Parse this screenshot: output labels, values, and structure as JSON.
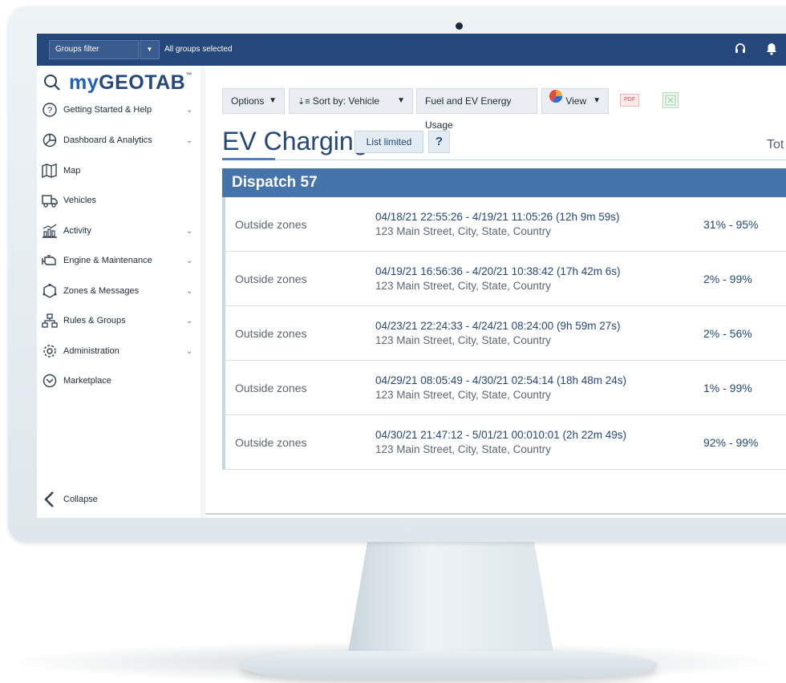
{
  "topbar": {
    "groups_filter_label": "Groups filter",
    "groups_selected_text": "All groups selected",
    "headset_icon": "headset-icon",
    "bell_icon": "bell-icon"
  },
  "sidebar": {
    "logo": {
      "my": "my",
      "rest": "GEOTAB",
      "tm": "™"
    },
    "items": [
      {
        "label": "Getting Started & Help",
        "icon": "question-circle-icon",
        "chevron": "⌄"
      },
      {
        "label": "Dashboard & Analytics",
        "icon": "pie-chart-icon",
        "chevron": "⌄"
      },
      {
        "label": "Map",
        "icon": "map-icon",
        "chevron": ""
      },
      {
        "label": "Vehicles",
        "icon": "truck-icon",
        "chevron": ""
      },
      {
        "label": "Activity",
        "icon": "activity-chart-icon",
        "chevron": "⌄"
      },
      {
        "label": "Engine & Maintenance",
        "icon": "engine-icon",
        "chevron": "⌄"
      },
      {
        "label": "Zones & Messages",
        "icon": "zones-icon",
        "chevron": "⌄"
      },
      {
        "label": "Rules & Groups",
        "icon": "hierarchy-icon",
        "chevron": "⌄"
      },
      {
        "label": "Administration",
        "icon": "gear-icon",
        "chevron": "⌄"
      },
      {
        "label": "Marketplace",
        "icon": "marketplace-icon",
        "chevron": ""
      }
    ],
    "collapse_label": "Collapse"
  },
  "toolbar": {
    "options_label": "Options",
    "sort_label": "Sort by: Vehicle",
    "report_label": "Fuel and EV Energy Usage",
    "view_label": "View",
    "pdf_label": "PDF"
  },
  "page": {
    "title": "EV Charging",
    "list_limited_label": "List limited",
    "help_label": "?",
    "total_label": "Tot"
  },
  "group": {
    "name": "Dispatch 57",
    "rows": [
      {
        "zone": "Outside zones",
        "time": "04/18/21 22:55:26 - 4/19/21 11:05:26 (12h 9m 59s)",
        "address": "123 Main Street, City, State, Country",
        "soc": "31% - 95%"
      },
      {
        "zone": "Outside zones",
        "time": "04/19/21 16:56:36 - 4/20/21 10:38:42 (17h 42m 6s)",
        "address": "123 Main Street, City, State, Country",
        "soc": "2% - 99%"
      },
      {
        "zone": "Outside zones",
        "time": "04/23/21 22:24:33 - 4/24/21 08:24:00 (9h 59m 27s)",
        "address": "123 Main Street, City, State, Country",
        "soc": "2% - 56%"
      },
      {
        "zone": "Outside zones",
        "time": "04/29/21 08:05:49 - 4/30/21 02:54:14 (18h 48m 24s)",
        "address": "123 Main Street, City, State, Country",
        "soc": "1% - 99%"
      },
      {
        "zone": "Outside zones",
        "time": "04/30/21 21:47:12 - 5/01/21 00:010:01 (2h 22m 49s)",
        "address": "123 Main Street, City, State, Country",
        "soc": "92% - 99%"
      }
    ]
  },
  "colors": {
    "topbar": "#25477b",
    "group_header": "#4573ac",
    "accent_text": "#25477b"
  }
}
